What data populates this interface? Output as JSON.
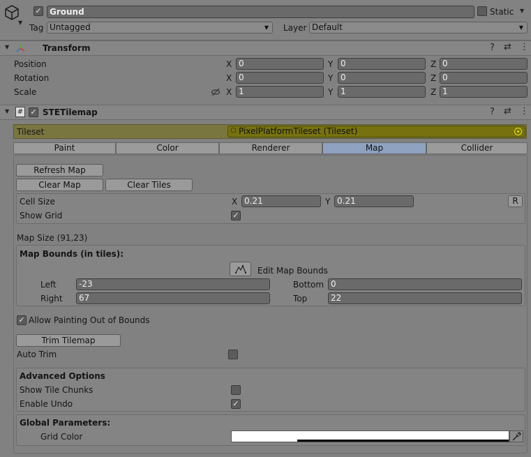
{
  "gameobject": {
    "name": "Ground",
    "static_label": "Static",
    "tag_label": "Tag",
    "tag_value": "Untagged",
    "layer_label": "Layer",
    "layer_value": "Default"
  },
  "transform": {
    "title": "Transform",
    "position_label": "Position",
    "rotation_label": "Rotation",
    "scale_label": "Scale",
    "axis_x": "X",
    "axis_y": "Y",
    "axis_z": "Z",
    "position": {
      "x": "0",
      "y": "0",
      "z": "0"
    },
    "rotation": {
      "x": "0",
      "y": "0",
      "z": "0"
    },
    "scale": {
      "x": "1",
      "y": "1",
      "z": "1"
    }
  },
  "tilemap": {
    "title": "STETilemap",
    "tileset_label": "Tileset",
    "tileset_value": "PixelPlatformTileset (Tileset)",
    "tabs": [
      "Paint",
      "Color",
      "Renderer",
      "Map",
      "Collider"
    ],
    "active_tab": "Map",
    "refresh_map": "Refresh Map",
    "clear_map": "Clear Map",
    "clear_tiles": "Clear Tiles",
    "cell_size_label": "Cell Size",
    "cell_x_label": "X",
    "cell_y_label": "Y",
    "cell_x": "0.21",
    "cell_y": "0.21",
    "reset_button": "R",
    "show_grid_label": "Show Grid",
    "map_size": "Map Size (91,23)",
    "map_bounds_title": "Map Bounds (in tiles):",
    "edit_map_bounds": "Edit Map Bounds",
    "left_label": "Left",
    "left_value": "-23",
    "right_label": "Right",
    "right_value": "67",
    "bottom_label": "Bottom",
    "bottom_value": "0",
    "top_label": "Top",
    "top_value": "22",
    "allow_painting_label": "Allow Painting Out of Bounds",
    "trim_tilemap": "Trim Tilemap",
    "auto_trim_label": "Auto Trim",
    "advanced_title": "Advanced Options",
    "show_tile_chunks_label": "Show Tile Chunks",
    "enable_undo_label": "Enable Undo",
    "global_params_title": "Global Parameters:",
    "grid_color_label": "Grid Color",
    "grid_color": "#ffffff"
  },
  "colors": {
    "tileset_bg": "#7a7640",
    "tileset_field": "#77720f",
    "active_tab": "#8ea2c0"
  }
}
